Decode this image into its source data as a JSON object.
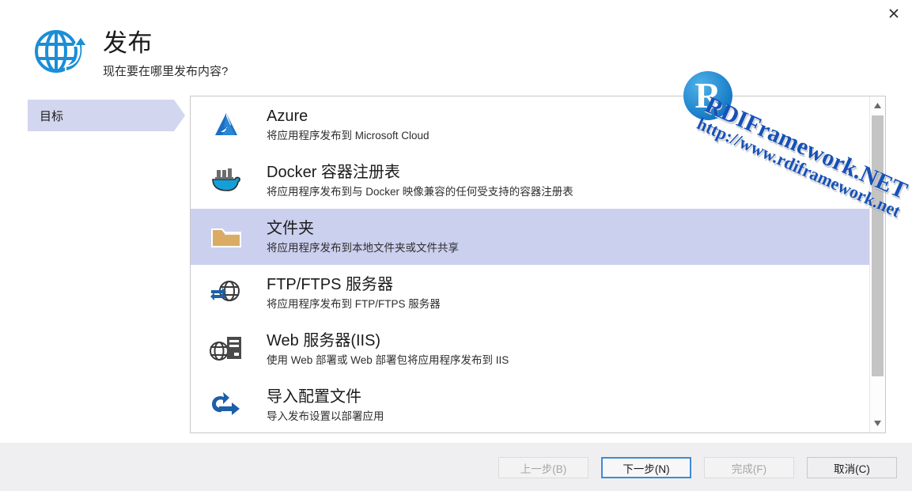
{
  "window": {
    "close_label": "✕"
  },
  "header": {
    "icon": "globe-publish-icon",
    "title": "发布",
    "subtitle": "现在要在哪里发布内容?"
  },
  "sidebar": {
    "steps": [
      {
        "label": "目标",
        "active": true
      }
    ]
  },
  "targets": [
    {
      "icon": "azure-icon",
      "title": "Azure",
      "desc": "将应用程序发布到 Microsoft Cloud",
      "selected": false
    },
    {
      "icon": "docker-icon",
      "title": "Docker 容器注册表",
      "desc": "将应用程序发布到与 Docker 映像兼容的任何受支持的容器注册表",
      "selected": false
    },
    {
      "icon": "folder-icon",
      "title": "文件夹",
      "desc": "将应用程序发布到本地文件夹或文件共享",
      "selected": true
    },
    {
      "icon": "ftp-globe-icon",
      "title": "FTP/FTPS 服务器",
      "desc": "将应用程序发布到 FTP/FTPS 服务器",
      "selected": false
    },
    {
      "icon": "iis-server-icon",
      "title": "Web 服务器(IIS)",
      "desc": "使用 Web 部署或 Web 部署包将应用程序发布到 IIS",
      "selected": false
    },
    {
      "icon": "import-arrow-icon",
      "title": "导入配置文件",
      "desc": "导入发布设置以部署应用",
      "selected": false
    }
  ],
  "footer": {
    "buttons": [
      {
        "label": "上一步(B)",
        "state": "disabled"
      },
      {
        "label": "下一步(N)",
        "state": "focused"
      },
      {
        "label": "完成(F)",
        "state": "disabled"
      },
      {
        "label": "取消(C)",
        "state": "normal"
      }
    ]
  },
  "watermark": {
    "main": "RDIFramework.NET",
    "sub": "http://www.rdiframework.net",
    "logo_letter": "R"
  },
  "colors": {
    "accent": "#1b8ed6",
    "selection": "#ccd0ef",
    "nav_active": "#d3d6ef",
    "footer_bg": "#efeff1",
    "focus_border": "#3f8ad8",
    "watermark_blue": "#1651b8"
  }
}
